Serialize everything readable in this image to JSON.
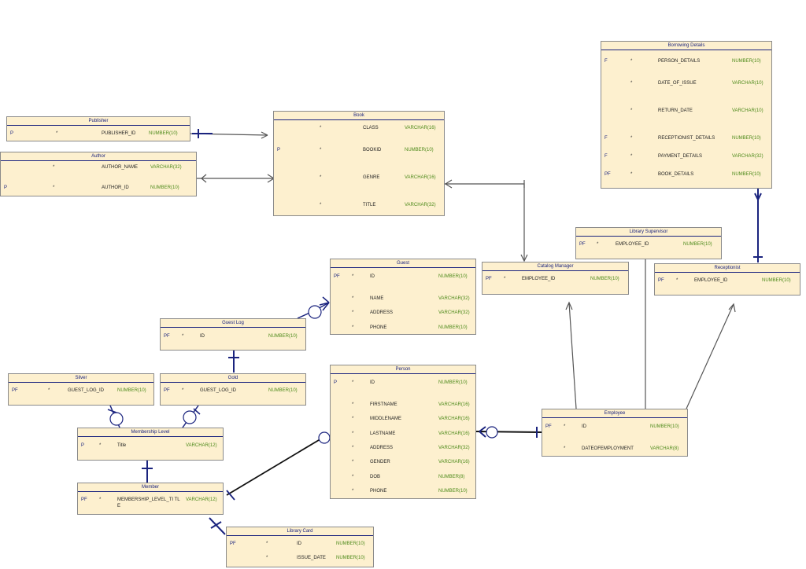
{
  "diagram": {
    "entities": [
      {
        "id": "borrowing_details",
        "name": "Borrowing Details",
        "rows": [
          {
            "key": "F",
            "req": "*",
            "col": "PERSON_DETAILS",
            "type": "NUMBER(10)"
          },
          {
            "key": "",
            "req": "*",
            "col": "DATE_OF_ISSUE",
            "type": "VARCHAR(10)"
          },
          {
            "key": "",
            "req": "*",
            "col": "RETURN_DATE",
            "type": "VARCHAR(10)"
          },
          {
            "key": "F",
            "req": "*",
            "col": "RECEPTIONIST_DETAILS",
            "type": "NUMBER(10)"
          },
          {
            "key": "F",
            "req": "*",
            "col": "PAYMENT_DETAILS",
            "type": "VARCHAR(32)"
          },
          {
            "key": "PF",
            "req": "*",
            "col": "BOOK_DETAILS",
            "type": "NUMBER(10)"
          }
        ]
      },
      {
        "id": "publisher",
        "name": "Publisher",
        "rows": [
          {
            "key": "P",
            "req": "*",
            "col": "PUBLISHER_ID",
            "type": "NUMBER(10)"
          }
        ]
      },
      {
        "id": "author",
        "name": "Author",
        "rows": [
          {
            "key": "",
            "req": "*",
            "col": "AUTHOR_NAME",
            "type": "VARCHAR(32)"
          },
          {
            "key": "P",
            "req": "*",
            "col": "AUTHOR_ID",
            "type": "NUMBER(10)"
          }
        ]
      },
      {
        "id": "book",
        "name": "Book",
        "rows": [
          {
            "key": "",
            "req": "*",
            "col": "CLASS",
            "type": "VARCHAR(16)"
          },
          {
            "key": "P",
            "req": "*",
            "col": "BOOKID",
            "type": "NUMBER(10)"
          },
          {
            "key": "",
            "req": "*",
            "col": "GENRE",
            "type": "VARCHAR(16)"
          },
          {
            "key": "",
            "req": "*",
            "col": "TITLE",
            "type": "VARCHAR(32)"
          }
        ]
      },
      {
        "id": "library_supervisor",
        "name": "Library Supervisor",
        "rows": [
          {
            "key": "PF",
            "req": "*",
            "col": "EMPLOYEE_ID",
            "type": "NUMBER(10)"
          }
        ]
      },
      {
        "id": "guest",
        "name": "Guest",
        "rows": [
          {
            "key": "PF",
            "req": "*",
            "col": "ID",
            "type": "NUMBER(10)"
          },
          {
            "key": "",
            "req": "*",
            "col": "NAME",
            "type": "VARCHAR(32)"
          },
          {
            "key": "",
            "req": "*",
            "col": "ADDRESS",
            "type": "VARCHAR(32)"
          },
          {
            "key": "",
            "req": "*",
            "col": "PHONE",
            "type": "NUMBER(10)"
          }
        ]
      },
      {
        "id": "catalog_manager",
        "name": "Catalog Manager",
        "rows": [
          {
            "key": "PF",
            "req": "*",
            "col": "EMPLOYEE_ID",
            "type": "NUMBER(10)"
          }
        ]
      },
      {
        "id": "receptionist",
        "name": "Receptionist",
        "rows": [
          {
            "key": "PF",
            "req": "*",
            "col": "EMPLOYEE_ID",
            "type": "NUMBER(10)"
          }
        ]
      },
      {
        "id": "guest_log",
        "name": "Guest Log",
        "rows": [
          {
            "key": "PF",
            "req": "*",
            "col": "ID",
            "type": "NUMBER(10)"
          }
        ]
      },
      {
        "id": "silver",
        "name": "Silver",
        "rows": [
          {
            "key": "PF",
            "req": "*",
            "col": "GUEST_LOG_ID",
            "type": "NUMBER(10)"
          }
        ]
      },
      {
        "id": "gold",
        "name": "Gold",
        "rows": [
          {
            "key": "PF",
            "req": "*",
            "col": "GUEST_LOG_ID",
            "type": "NUMBER(10)"
          }
        ]
      },
      {
        "id": "person",
        "name": "Person",
        "rows": [
          {
            "key": "P",
            "req": "*",
            "col": "ID",
            "type": "NUMBER(10)"
          },
          {
            "key": "",
            "req": "*",
            "col": "FIRSTNAME",
            "type": "VARCHAR(16)"
          },
          {
            "key": "",
            "req": "*",
            "col": "MIDDLENAME",
            "type": "VARCHAR(16)"
          },
          {
            "key": "",
            "req": "*",
            "col": "LASTNAME",
            "type": "VARCHAR(16)"
          },
          {
            "key": "",
            "req": "*",
            "col": "ADDRESS",
            "type": "VARCHAR(32)"
          },
          {
            "key": "",
            "req": "*",
            "col": "GENDER",
            "type": "VARCHAR(16)"
          },
          {
            "key": "",
            "req": "*",
            "col": "DOB",
            "type": "NUMBER(8)"
          },
          {
            "key": "",
            "req": "*",
            "col": "PHONE",
            "type": "NUMBER(10)"
          }
        ]
      },
      {
        "id": "employee",
        "name": "Employee",
        "rows": [
          {
            "key": "PF",
            "req": "*",
            "col": "ID",
            "type": "NUMBER(10)"
          },
          {
            "key": "",
            "req": "*",
            "col": "DATEOFEMPLOYMENT",
            "type": "VARCHAR(8)"
          }
        ]
      },
      {
        "id": "membership_level",
        "name": "Membership Level",
        "rows": [
          {
            "key": "P",
            "req": "*",
            "col": "Title",
            "type": "VARCHAR(12)"
          }
        ]
      },
      {
        "id": "member",
        "name": "Member",
        "rows": [
          {
            "key": "PF",
            "req": "*",
            "col": "MEMBERSHIP_LEVEL_TI TLE",
            "type": "VARCHAR(12)"
          }
        ]
      },
      {
        "id": "library_card",
        "name": "Library Card",
        "rows": [
          {
            "key": "PF",
            "req": "*",
            "col": "ID",
            "type": "NUMBER(10)"
          },
          {
            "key": "",
            "req": "*",
            "col": "ISSUE_DATE",
            "type": "NUMBER(10)"
          }
        ]
      }
    ]
  },
  "colors": {
    "entity_fill": "#fdf0cf",
    "header_text": "#1a237e",
    "type_text": "#4d8a1a",
    "line": "#1a237e",
    "link": "#555555"
  }
}
